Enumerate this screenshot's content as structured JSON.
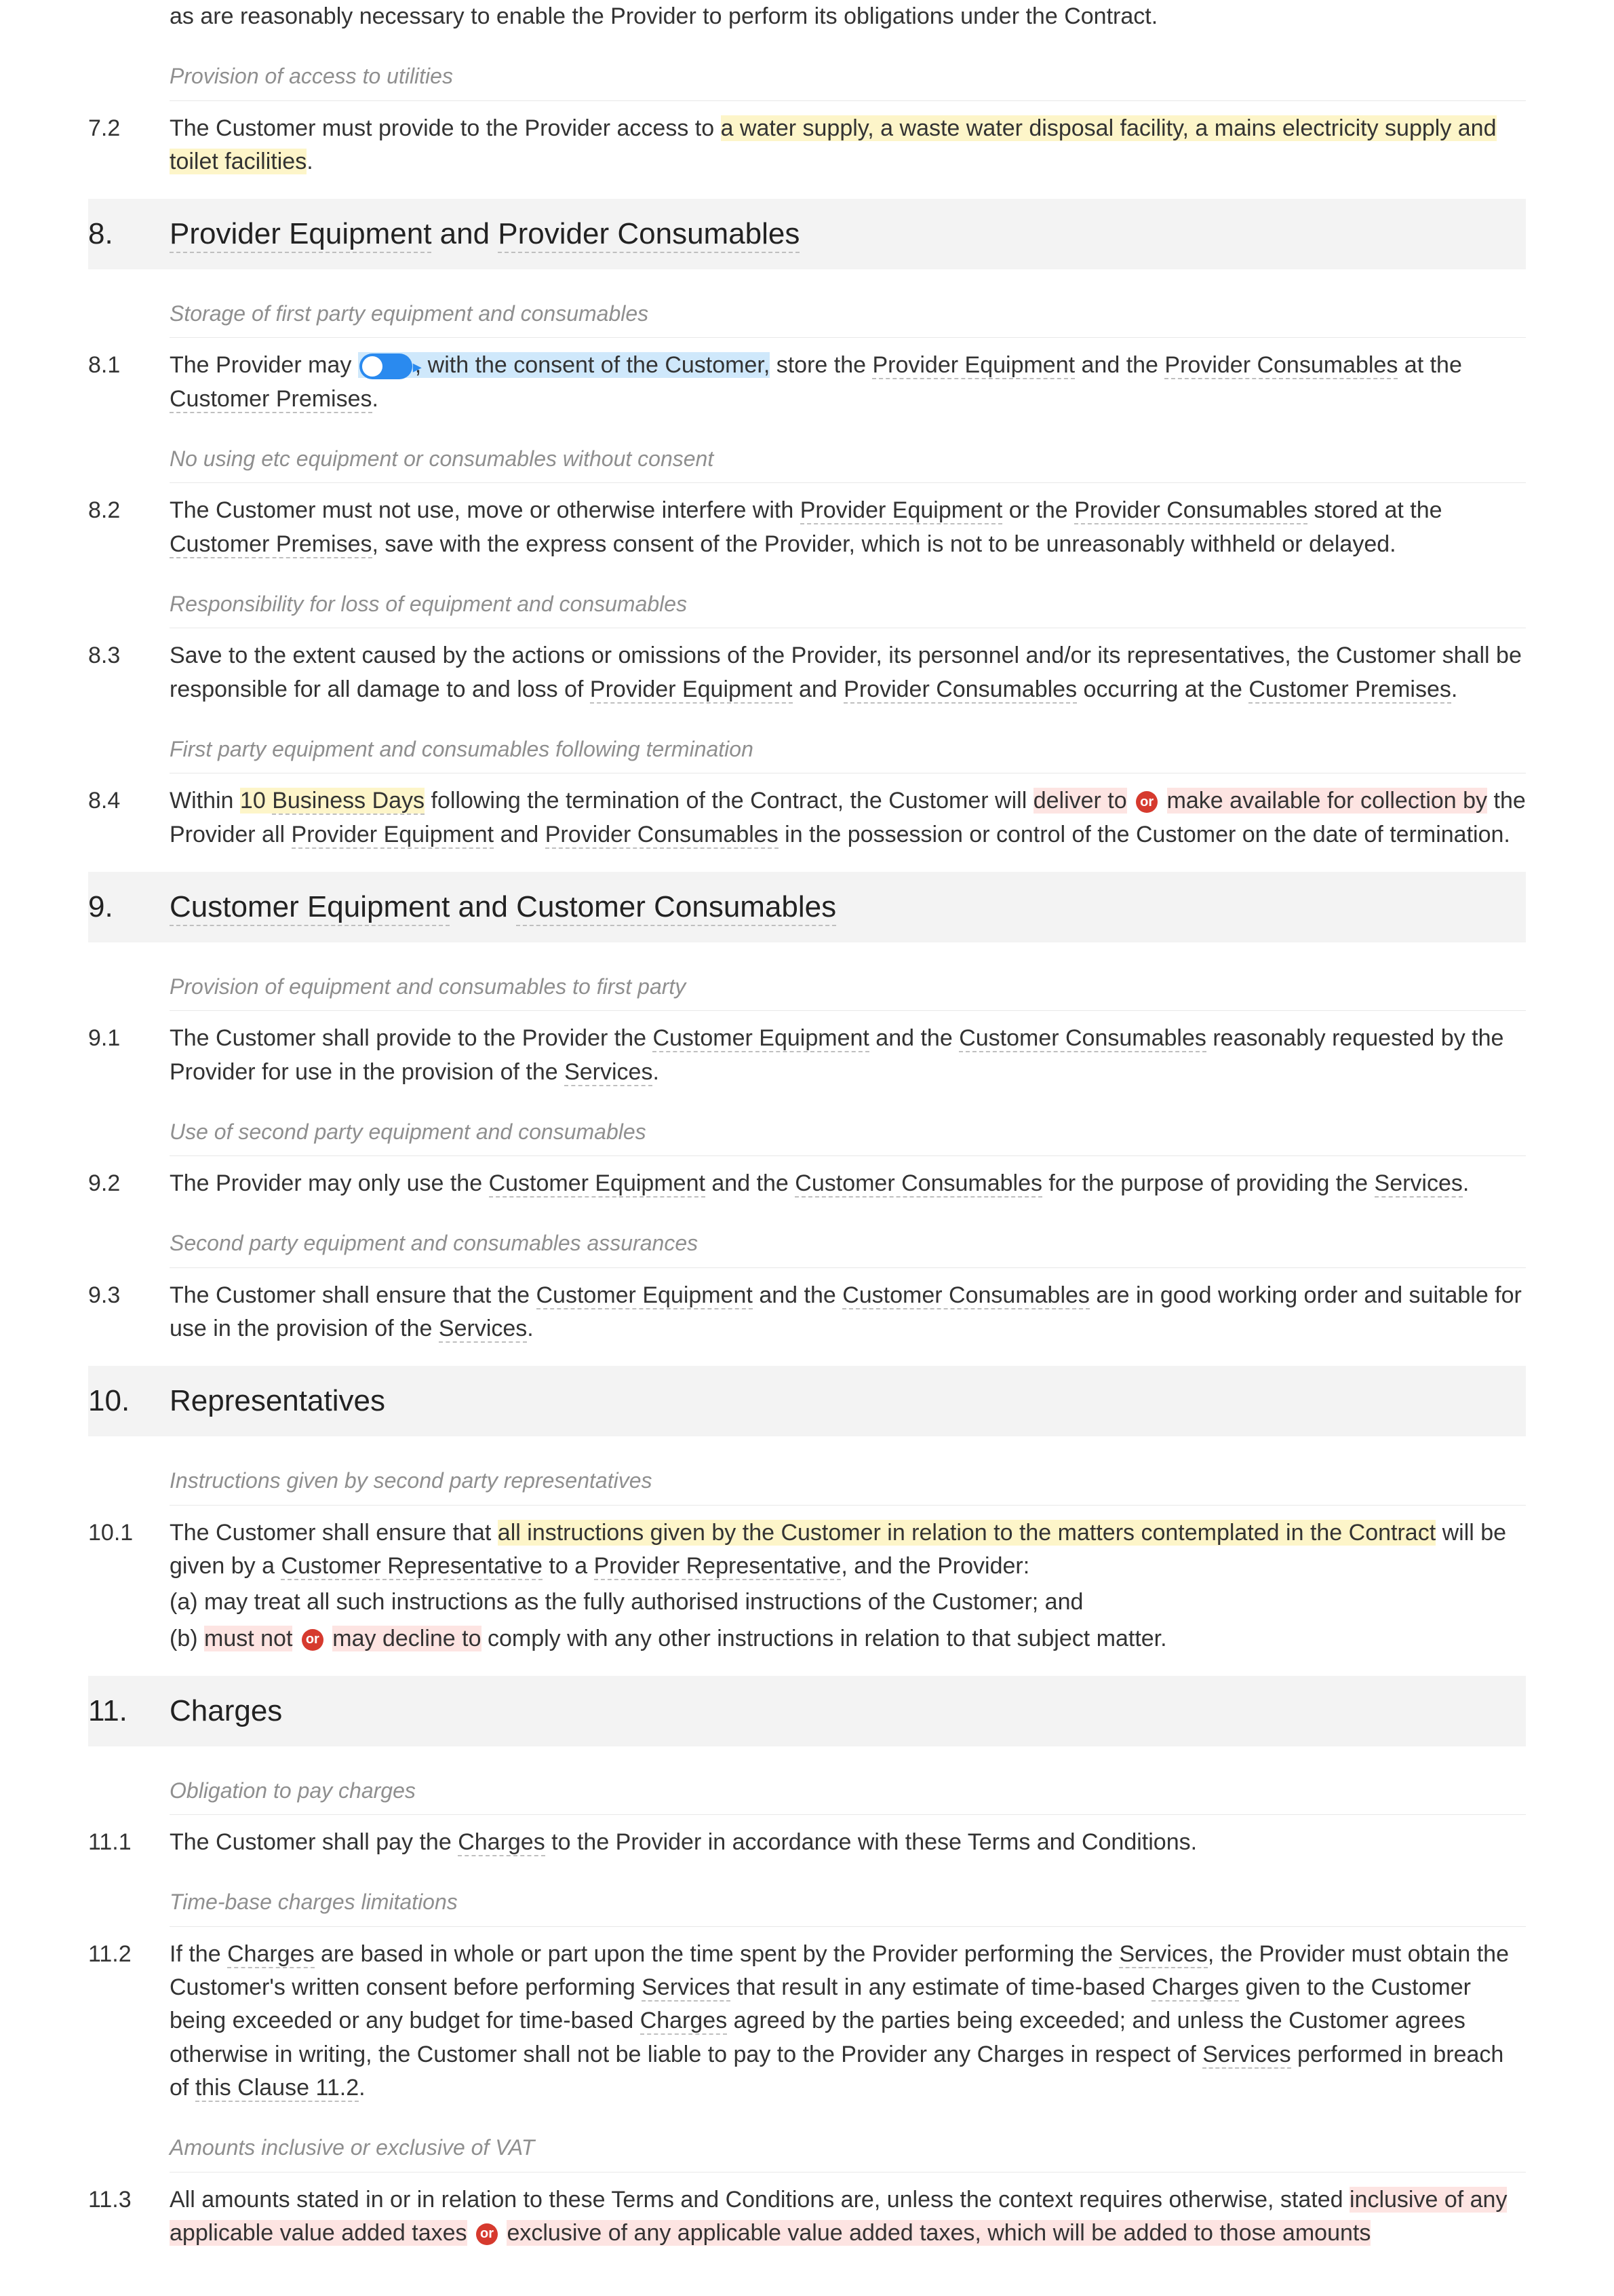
{
  "intro": {
    "line": "as are reasonably necessary to enable the Provider to perform its obligations under the Contract."
  },
  "sub_access": "Provision of access to utilities",
  "c72": {
    "num": "7.2",
    "t1": "The Customer must provide to the Provider access to ",
    "hl": "a water supply, a waste water disposal facility, a mains electricity supply and toilet facilities",
    "t2": "."
  },
  "s8": {
    "num": "8.",
    "title_a": "Provider Equipment",
    "title_mid": " and ",
    "title_b": "Provider Consumables"
  },
  "sub81": "Storage of first party equipment and consumables",
  "c81": {
    "num": "8.1",
    "t1": "The Provider may ",
    "hl_blue": ", with the consent of the Customer,",
    "t2": " store the ",
    "d1": "Provider Equipment",
    "t3": " and the ",
    "d2": "Provider Consumables",
    "t4": " at the ",
    "d3": "Customer Premises",
    "t5": "."
  },
  "sub82": "No using etc equipment or consumables without consent",
  "c82": {
    "num": "8.2",
    "t1": "The Customer must not use, move or otherwise interfere with ",
    "d1": "Provider Equipment",
    "t2": " or the ",
    "d2": "Provider Consumables",
    "t3": " stored at the ",
    "d3": "Customer Premises",
    "t4": ", save with the express consent of the Provider, which is not to be unreasonably withheld or delayed."
  },
  "sub83": "Responsibility for loss of equipment and consumables",
  "c83": {
    "num": "8.3",
    "t1": "Save to the extent caused by the actions or omissions of the Provider, its personnel and/or its representatives, the Customer shall be responsible for all damage to and loss of ",
    "d1": "Provider Equipment",
    "t2": " and ",
    "d2": "Provider Consumables",
    "t3": " occurring at the ",
    "d3": "Customer Premises",
    "t4": "."
  },
  "sub84": "First party equipment and consumables following termination",
  "c84": {
    "num": "8.4",
    "t1": "Within ",
    "hl_y": "10 ",
    "dy": "Business Days",
    "t2": " following the termination of the Contract, the Customer will ",
    "hl_r1": "deliver to",
    "or": "or",
    "hl_r2": "make available for collection by",
    "t3": " the Provider all ",
    "d1": "Provider Equipment",
    "t4": " and ",
    "d2": "Provider Consumables",
    "t5": " in the possession or control of the Customer on the date of termination."
  },
  "s9": {
    "num": "9.",
    "title_a": "Customer Equipment",
    "title_mid": " and ",
    "title_b": "Customer Consumables"
  },
  "sub91": "Provision of equipment and consumables to first party",
  "c91": {
    "num": "9.1",
    "t1": "The Customer shall provide to the Provider the ",
    "d1": "Customer Equipment",
    "t2": " and the ",
    "d2": "Customer Consumables",
    "t3": " reasonably requested by the Provider for use in the provision of the ",
    "d3": "Services",
    "t4": "."
  },
  "sub92": "Use of second party equipment and consumables",
  "c92": {
    "num": "9.2",
    "t1": "The Provider may only use the ",
    "d1": "Customer Equipment",
    "t2": " and the ",
    "d2": "Customer Consumables",
    "t3": " for the purpose of providing the ",
    "d3": "Services",
    "t4": "."
  },
  "sub93": "Second party equipment and consumables assurances",
  "c93": {
    "num": "9.3",
    "t1": "The Customer shall ensure that the ",
    "d1": "Customer Equipment",
    "t2": " and the ",
    "d2": "Customer Consumables",
    "t3": " are in good working order and suitable for use in the provision of the ",
    "d3": "Services",
    "t4": "."
  },
  "s10": {
    "num": "10.",
    "title": "Representatives"
  },
  "sub101": "Instructions given by second party representatives",
  "c101": {
    "num": "10.1",
    "t1": "The Customer shall ensure that ",
    "hl_y": "all instructions given by the Customer in relation to the matters contemplated in the Contract",
    "t2": " will be given by a ",
    "d1": "Customer Representative",
    "t3": " to a ",
    "d2": "Provider Representative",
    "t4": ", and the Provider:",
    "a": "(a)  may treat all such instructions as the fully authorised instructions of the Customer; and",
    "b_pre": "(b)  ",
    "b_r1": "must not",
    "or": "or",
    "b_r2": "may decline to",
    "b_post": " comply with any other instructions in relation to that subject matter."
  },
  "s11": {
    "num": "11.",
    "title": "Charges"
  },
  "sub111": "Obligation to pay charges",
  "c111": {
    "num": "11.1",
    "t1": "The Customer shall pay the ",
    "d1": "Charges",
    "t2": " to the Provider in accordance with these Terms and Conditions."
  },
  "sub112": "Time-base charges limitations",
  "c112": {
    "num": "11.2",
    "t1": "If the ",
    "d1": "Charges",
    "t2": " are based in whole or part upon the time spent by the Provider performing the ",
    "d2": "Services",
    "t3": ", the Provider must obtain the Customer's written consent before performing ",
    "d3": "Services",
    "t4": " that result in any estimate of time-based ",
    "d4": "Charges",
    "t5": " given to the Customer being exceeded or any budget for time-based ",
    "d5": "Charges",
    "t6": " agreed by the parties being exceeded; and unless the Customer agrees otherwise in writing, the Customer shall not be liable to pay to the Provider any Charges in respect of ",
    "d6": "Services",
    "t7": " performed in breach of ",
    "d7": "this Clause 11.2",
    "t8": "."
  },
  "sub113": "Amounts inclusive or exclusive of VAT",
  "c113": {
    "num": "11.3",
    "t1": "All amounts stated in or in relation to these Terms and Conditions are, unless the context requires otherwise, stated ",
    "hl_r1": "inclusive of any applicable value added taxes",
    "or": "or",
    "hl_r2": "exclusive of any applicable value added taxes, which will be added to those amounts"
  }
}
